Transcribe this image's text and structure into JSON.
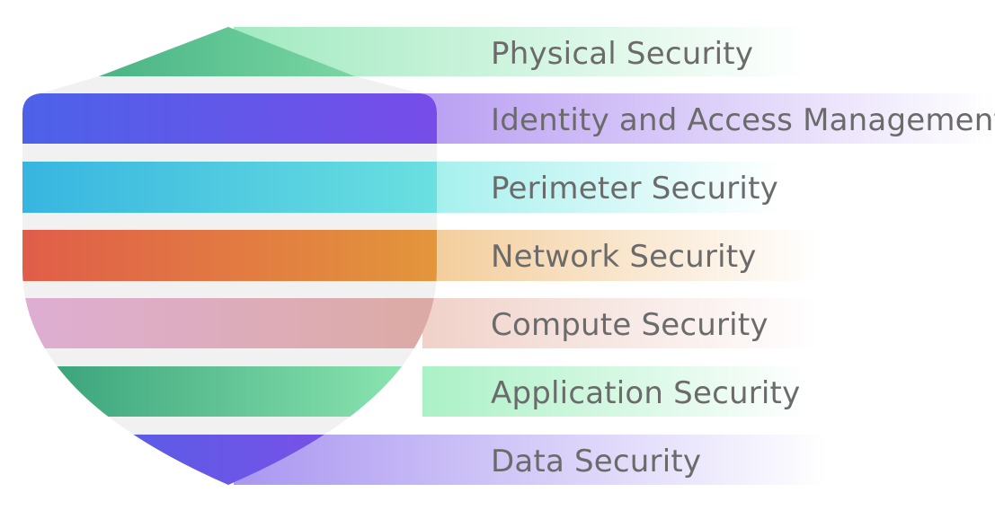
{
  "layers": [
    {
      "label": "Physical Security",
      "colors": [
        "#36a67a",
        "#8fe6b0"
      ],
      "accent": "#9de9bd"
    },
    {
      "label": "Identity and Access Management",
      "colors": [
        "#4a63e8",
        "#7a4be8"
      ],
      "accent": "#b69af2"
    },
    {
      "label": "Perimeter Security",
      "colors": [
        "#34b3e0",
        "#6ee3e0"
      ],
      "accent": "#9defec"
    },
    {
      "label": "Network Security",
      "colors": [
        "#e05a4a",
        "#e39a3a"
      ],
      "accent": "#f2c993"
    },
    {
      "label": "Compute Security",
      "colors": [
        "#deaed6",
        "#dcaaa0"
      ],
      "accent": "#efcfc6"
    },
    {
      "label": "Application Security",
      "colors": [
        "#2f9a74",
        "#98f0b9"
      ],
      "accent": "#a6f0c3"
    },
    {
      "label": "Data Security",
      "colors": [
        "#4a63e8",
        "#8a4ae6"
      ],
      "accent": "#a591f0"
    }
  ]
}
